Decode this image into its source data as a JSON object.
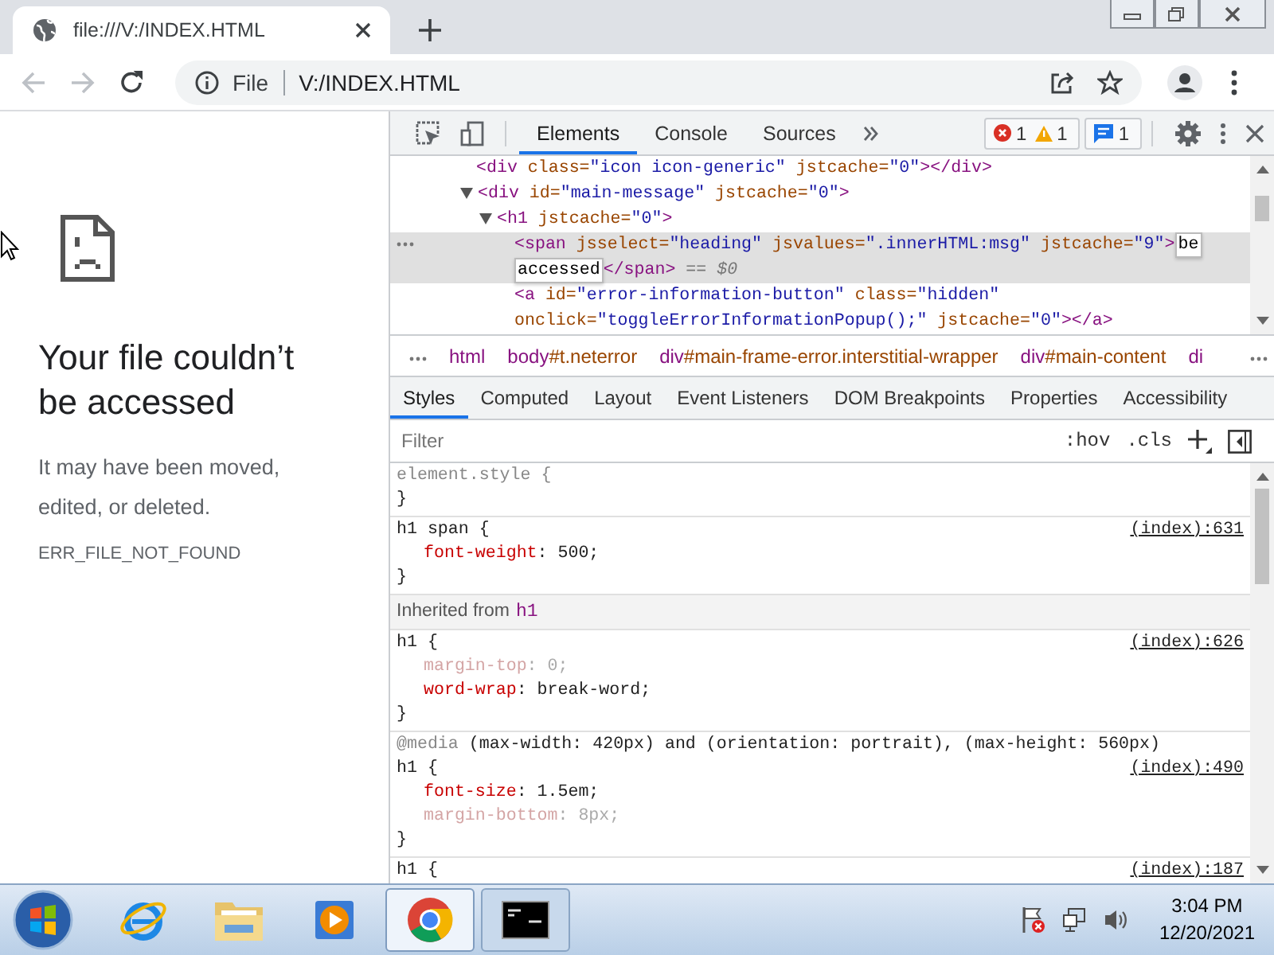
{
  "browser_tab": {
    "title": "file:///V:/INDEX.HTML",
    "selected": true
  },
  "nav": {
    "back_disabled": true,
    "forward_disabled": true
  },
  "address_bar": {
    "scheme": "File",
    "url": "V:/INDEX.HTML"
  },
  "page": {
    "heading": "Your file couldn’t be accessed",
    "message": "It may have been moved, edited, or deleted.",
    "error_code": "ERR_FILE_NOT_FOUND"
  },
  "devtools": {
    "tabs": [
      {
        "label": "Elements",
        "selected": true
      },
      {
        "label": "Console",
        "selected": false
      },
      {
        "label": "Sources",
        "selected": false
      }
    ],
    "issue_badges": [
      {
        "items": [
          {
            "kind": "error",
            "count": "1"
          },
          {
            "kind": "warning",
            "count": "1"
          }
        ]
      },
      {
        "items": [
          {
            "kind": "message",
            "count": "1"
          }
        ]
      }
    ],
    "dom_tree": [
      {
        "selected": false,
        "tokens": [
          {
            "kind": "tag",
            "text": "<div"
          },
          {
            "kind": "attr",
            "text": " class="
          },
          {
            "kind": "value",
            "text": "\"icon icon-generic\""
          },
          {
            "kind": "attr",
            "text": " jstcache="
          },
          {
            "kind": "value",
            "text": "\"0\""
          },
          {
            "kind": "tag",
            "text": "></div>"
          }
        ]
      },
      {
        "selected": false,
        "expanded": true,
        "tokens": [
          {
            "kind": "tag",
            "text": "<div"
          },
          {
            "kind": "attr",
            "text": " id="
          },
          {
            "kind": "value",
            "text": "\"main-message\""
          },
          {
            "kind": "attr",
            "text": " jstcache="
          },
          {
            "kind": "value",
            "text": "\"0\""
          },
          {
            "kind": "tag",
            "text": ">"
          }
        ],
        "children": [
          {
            "selected": false,
            "expanded": true,
            "tokens": [
              {
                "kind": "tag",
                "text": "<h1"
              },
              {
                "kind": "attr",
                "text": " jstcache="
              },
              {
                "kind": "value",
                "text": "\"0\""
              },
              {
                "kind": "tag",
                "text": ">"
              }
            ],
            "children": [
              {
                "selected": true,
                "tokens": [
                  {
                    "kind": "tag",
                    "text": "<span"
                  },
                  {
                    "kind": "attr",
                    "text": " jsselect="
                  },
                  {
                    "kind": "value",
                    "text": "\"heading\""
                  },
                  {
                    "kind": "attr",
                    "text": " jsvalues="
                  },
                  {
                    "kind": "value",
                    "text": "\".innerHTML:msg\""
                  },
                  {
                    "kind": "attr",
                    "text": " jstcache="
                  },
                  {
                    "kind": "value",
                    "text": "\"9\""
                  },
                  {
                    "kind": "tag",
                    "text": ">"
                  },
                  {
                    "kind": "edit",
                    "text": "be"
                  },
                  {
                    "kind": "edit",
                    "text": "accessed"
                  },
                  {
                    "kind": "tag",
                    "text": "</span>"
                  },
                  {
                    "kind": "eq",
                    "text": " == $0"
                  }
                ]
              },
              {
                "selected": false,
                "tokens": [
                  {
                    "kind": "tag",
                    "text": "<a"
                  },
                  {
                    "kind": "attr",
                    "text": " id="
                  },
                  {
                    "kind": "value",
                    "text": "\"error-information-button\""
                  },
                  {
                    "kind": "attr",
                    "text": " class="
                  },
                  {
                    "kind": "value",
                    "text": "\"hidden\""
                  },
                  {
                    "kind": "attr",
                    "text": " onclick="
                  },
                  {
                    "kind": "value",
                    "text": "\"toggleErrorInformationPopup();\""
                  },
                  {
                    "kind": "attr",
                    "text": " jstcache="
                  },
                  {
                    "kind": "value",
                    "text": "\"0\""
                  },
                  {
                    "kind": "tag",
                    "text": "></a>"
                  }
                ]
              }
            ]
          }
        ]
      }
    ],
    "breadcrumbs": [
      {
        "tag": "html"
      },
      {
        "tag": "body",
        "rest": "#t.neterror"
      },
      {
        "tag": "div",
        "rest": "#main-frame-error.interstitial-wrapper"
      },
      {
        "tag": "div",
        "rest": "#main-content"
      },
      {
        "tag": "di"
      }
    ],
    "sidebar_tabs": [
      {
        "label": "Styles",
        "selected": true
      },
      {
        "label": "Computed",
        "selected": false
      },
      {
        "label": "Layout",
        "selected": false
      },
      {
        "label": "Event Listeners",
        "selected": false
      },
      {
        "label": "DOM Breakpoints",
        "selected": false
      },
      {
        "label": "Properties",
        "selected": false
      },
      {
        "label": "Accessibility",
        "selected": false
      }
    ],
    "filter": {
      "placeholder": "Filter",
      "hov": ":hov",
      "cls": ".cls"
    },
    "rules": [
      {
        "kind": "rule",
        "inline": true,
        "selector": "element.style {",
        "close": "}"
      },
      {
        "kind": "rule",
        "inline": false,
        "selector": "h1 span {",
        "source": "(index):631",
        "close": "}",
        "declarations": [
          {
            "prop": "font-weight",
            "value": ": 500;",
            "inactive": false
          }
        ]
      },
      {
        "kind": "inherited",
        "label": "Inherited from",
        "element": "h1"
      },
      {
        "kind": "rule",
        "inline": false,
        "selector": "h1 {",
        "source": "(index):626",
        "close": "}",
        "declarations": [
          {
            "prop": "margin-top",
            "value": ": 0;",
            "inactive": true
          },
          {
            "prop": "word-wrap",
            "value": ": break-word;",
            "inactive": false
          }
        ]
      },
      {
        "kind": "rule",
        "inline": false,
        "media": "@media",
        "media_query": " (max-width: 420px) and (orientation: portrait), (max-height: 560px)",
        "selector": "h1 {",
        "source": "(index):490",
        "close": "}",
        "declarations": [
          {
            "prop": "font-size",
            "value": ": 1.5em;",
            "inactive": false
          },
          {
            "prop": "margin-bottom",
            "value": ": 8px;",
            "inactive": true
          }
        ]
      },
      {
        "kind": "rule",
        "inline": false,
        "selector": "h1 {",
        "source": "(index):187"
      }
    ]
  },
  "taskbar": {
    "items": [
      {
        "kind": "start",
        "selected": false,
        "running": false
      },
      {
        "kind": "ie",
        "selected": false,
        "running": false
      },
      {
        "kind": "explorer",
        "selected": false,
        "running": false
      },
      {
        "kind": "media",
        "selected": false,
        "running": false
      },
      {
        "kind": "chrome",
        "selected": true,
        "running": true
      },
      {
        "kind": "cmd",
        "selected": false,
        "running": true
      }
    ],
    "clock": {
      "time": "3:04 PM",
      "date": "12/20/2021"
    }
  }
}
